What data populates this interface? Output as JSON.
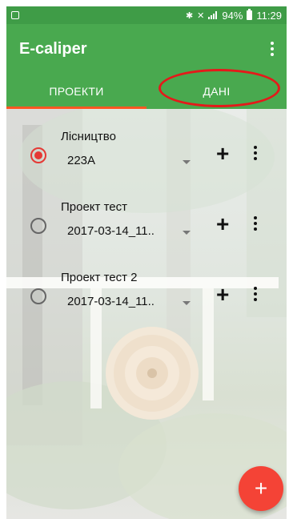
{
  "status_bar": {
    "battery": "94%",
    "time": "11:29"
  },
  "app_bar": {
    "title": "E-caliper"
  },
  "tabs": [
    {
      "label": "ПРОЕКТИ",
      "selected": true
    },
    {
      "label": "ДАНІ",
      "selected": false
    }
  ],
  "projects": [
    {
      "name": "Лісництво",
      "value": "223A",
      "selected": true
    },
    {
      "name": "Проект тест",
      "value": "2017-03-14_11..",
      "selected": false
    },
    {
      "name": "Проект тест 2",
      "value": "2017-03-14_11..",
      "selected": false
    }
  ],
  "icons": {
    "add_item": "+",
    "fab": "+"
  },
  "colors": {
    "primary": "#49a94f",
    "status_bar": "#3f9c47",
    "tab_indicator": "#ff5722",
    "radio_selected": "#e53935",
    "fab": "#f44336",
    "annotation": "#e5191a"
  }
}
